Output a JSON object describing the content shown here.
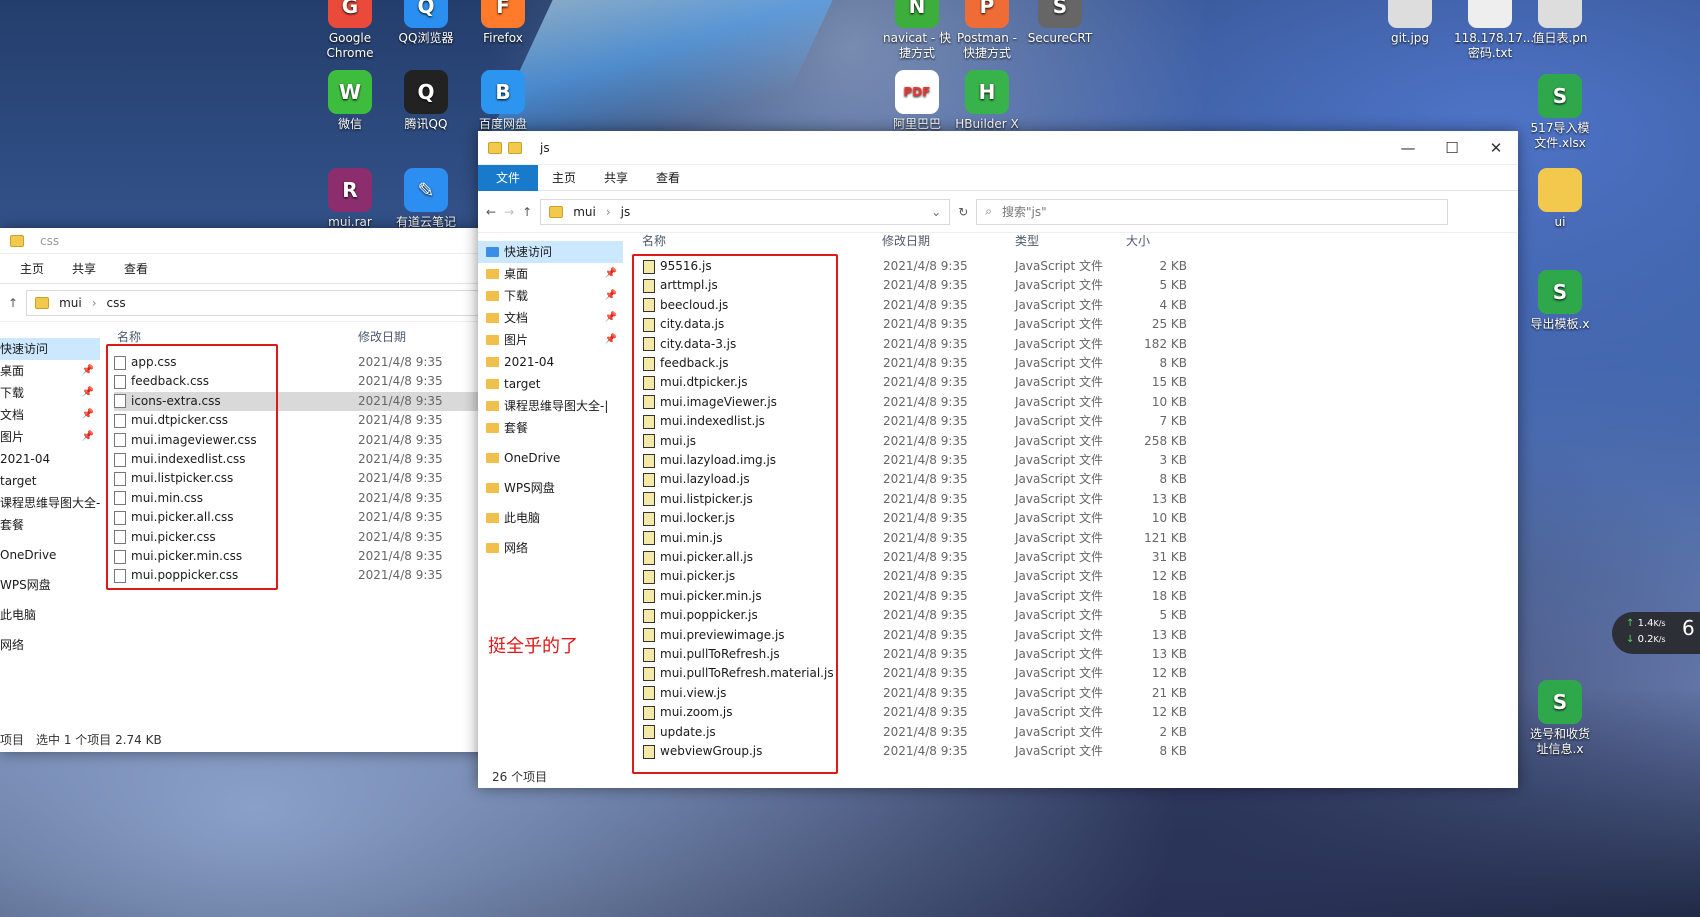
{
  "desktop": {
    "icons": [
      {
        "label": "Google\nChrome",
        "color": "#e94a3a",
        "glyph": "G"
      },
      {
        "label": "QQ浏览器",
        "color": "#2a8ff0",
        "glyph": "Q"
      },
      {
        "label": "Firefox",
        "color": "#ff7a2a",
        "glyph": "F"
      },
      {
        "label": "navicat - 快\n捷方式",
        "color": "#3cae3c",
        "glyph": "N"
      },
      {
        "label": "Postman -\n快捷方式",
        "color": "#ef6c37",
        "glyph": "P"
      },
      {
        "label": "SecureCRT",
        "color": "#666",
        "glyph": "S"
      },
      {
        "label": "git.jpg",
        "color": "#ddd",
        "glyph": ""
      },
      {
        "label": "118.178.17...\n密码.txt",
        "color": "#eee",
        "glyph": ""
      },
      {
        "label": "值日表.pn",
        "color": "#ddd",
        "glyph": ""
      },
      {
        "label": "微信",
        "color": "#3ebc3e",
        "glyph": "W"
      },
      {
        "label": "腾讯QQ",
        "color": "#222",
        "glyph": "Q"
      },
      {
        "label": "百度网盘",
        "color": "#2b95f0",
        "glyph": "B"
      },
      {
        "label": "阿里巴巴",
        "color": "#ffffff",
        "glyph": "PDF"
      },
      {
        "label": "HBuilder X",
        "color": "#38b24a",
        "glyph": "H"
      },
      {
        "label": "517导入模\n文件.xlsx",
        "color": "#2ea84a",
        "glyph": "S"
      },
      {
        "label": "mui.rar",
        "color": "#8c2d6e",
        "glyph": "R"
      },
      {
        "label": "有道云笔记",
        "color": "#2b8ef0",
        "glyph": "✎"
      },
      {
        "label": "ui",
        "color": "#f2c94c",
        "glyph": ""
      },
      {
        "label": "导出模板.x",
        "color": "#2ea84a",
        "glyph": "S"
      },
      {
        "label": "选号和收货\n址信息.x",
        "color": "#2ea84a",
        "glyph": "S"
      }
    ],
    "net": {
      "up": "1.4",
      "down": "0.2",
      "unit": "K/s",
      "num": "6"
    }
  },
  "win_css": {
    "title": "css",
    "tabs": [
      "主页",
      "共享",
      "查看"
    ],
    "path": [
      "mui",
      "css"
    ],
    "headers": [
      "名称",
      "修改日期"
    ],
    "nav": [
      "快速访问",
      "桌面",
      "下载",
      "文档",
      "图片",
      "2021-04",
      "target",
      "课程思维导图大全-",
      "套餐",
      "OneDrive",
      "WPS网盘",
      "此电脑",
      "网络"
    ],
    "files": [
      "app.css",
      "feedback.css",
      "icons-extra.css",
      "mui.dtpicker.css",
      "mui.imageviewer.css",
      "mui.indexedlist.css",
      "mui.listpicker.css",
      "mui.min.css",
      "mui.picker.all.css",
      "mui.picker.css",
      "mui.picker.min.css",
      "mui.poppicker.css"
    ],
    "date": "2021/4/8 9:35",
    "status_items": "项目",
    "status_sel": "选中 1 个项目  2.74 KB"
  },
  "win_js": {
    "title": "js",
    "tabs": [
      "文件",
      "主页",
      "共享",
      "查看"
    ],
    "path": [
      "mui",
      "js"
    ],
    "search_placeholder": "搜索\"js\"",
    "headers": [
      "名称",
      "修改日期",
      "类型",
      "大小"
    ],
    "nav": [
      "快速访问",
      "桌面",
      "下载",
      "文档",
      "图片",
      "2021-04",
      "target",
      "课程思维导图大全-|",
      "套餐",
      "OneDrive",
      "WPS网盘",
      "此电脑",
      "网络"
    ],
    "files": [
      [
        "95516.js",
        "2 KB"
      ],
      [
        "arttmpl.js",
        "5 KB"
      ],
      [
        "beecloud.js",
        "4 KB"
      ],
      [
        "city.data.js",
        "25 KB"
      ],
      [
        "city.data-3.js",
        "182 KB"
      ],
      [
        "feedback.js",
        "8 KB"
      ],
      [
        "mui.dtpicker.js",
        "15 KB"
      ],
      [
        "mui.imageViewer.js",
        "10 KB"
      ],
      [
        "mui.indexedlist.js",
        "7 KB"
      ],
      [
        "mui.js",
        "258 KB"
      ],
      [
        "mui.lazyload.img.js",
        "3 KB"
      ],
      [
        "mui.lazyload.js",
        "8 KB"
      ],
      [
        "mui.listpicker.js",
        "13 KB"
      ],
      [
        "mui.locker.js",
        "10 KB"
      ],
      [
        "mui.min.js",
        "121 KB"
      ],
      [
        "mui.picker.all.js",
        "31 KB"
      ],
      [
        "mui.picker.js",
        "12 KB"
      ],
      [
        "mui.picker.min.js",
        "18 KB"
      ],
      [
        "mui.poppicker.js",
        "5 KB"
      ],
      [
        "mui.previewimage.js",
        "13 KB"
      ],
      [
        "mui.pullToRefresh.js",
        "13 KB"
      ],
      [
        "mui.pullToRefresh.material.js",
        "12 KB"
      ],
      [
        "mui.view.js",
        "21 KB"
      ],
      [
        "mui.zoom.js",
        "12 KB"
      ],
      [
        "update.js",
        "2 KB"
      ],
      [
        "webviewGroup.js",
        "8 KB"
      ]
    ],
    "date": "2021/4/8 9:35",
    "type": "JavaScript 文件",
    "status": "26 个项目",
    "annotation": "挺全乎的了"
  }
}
